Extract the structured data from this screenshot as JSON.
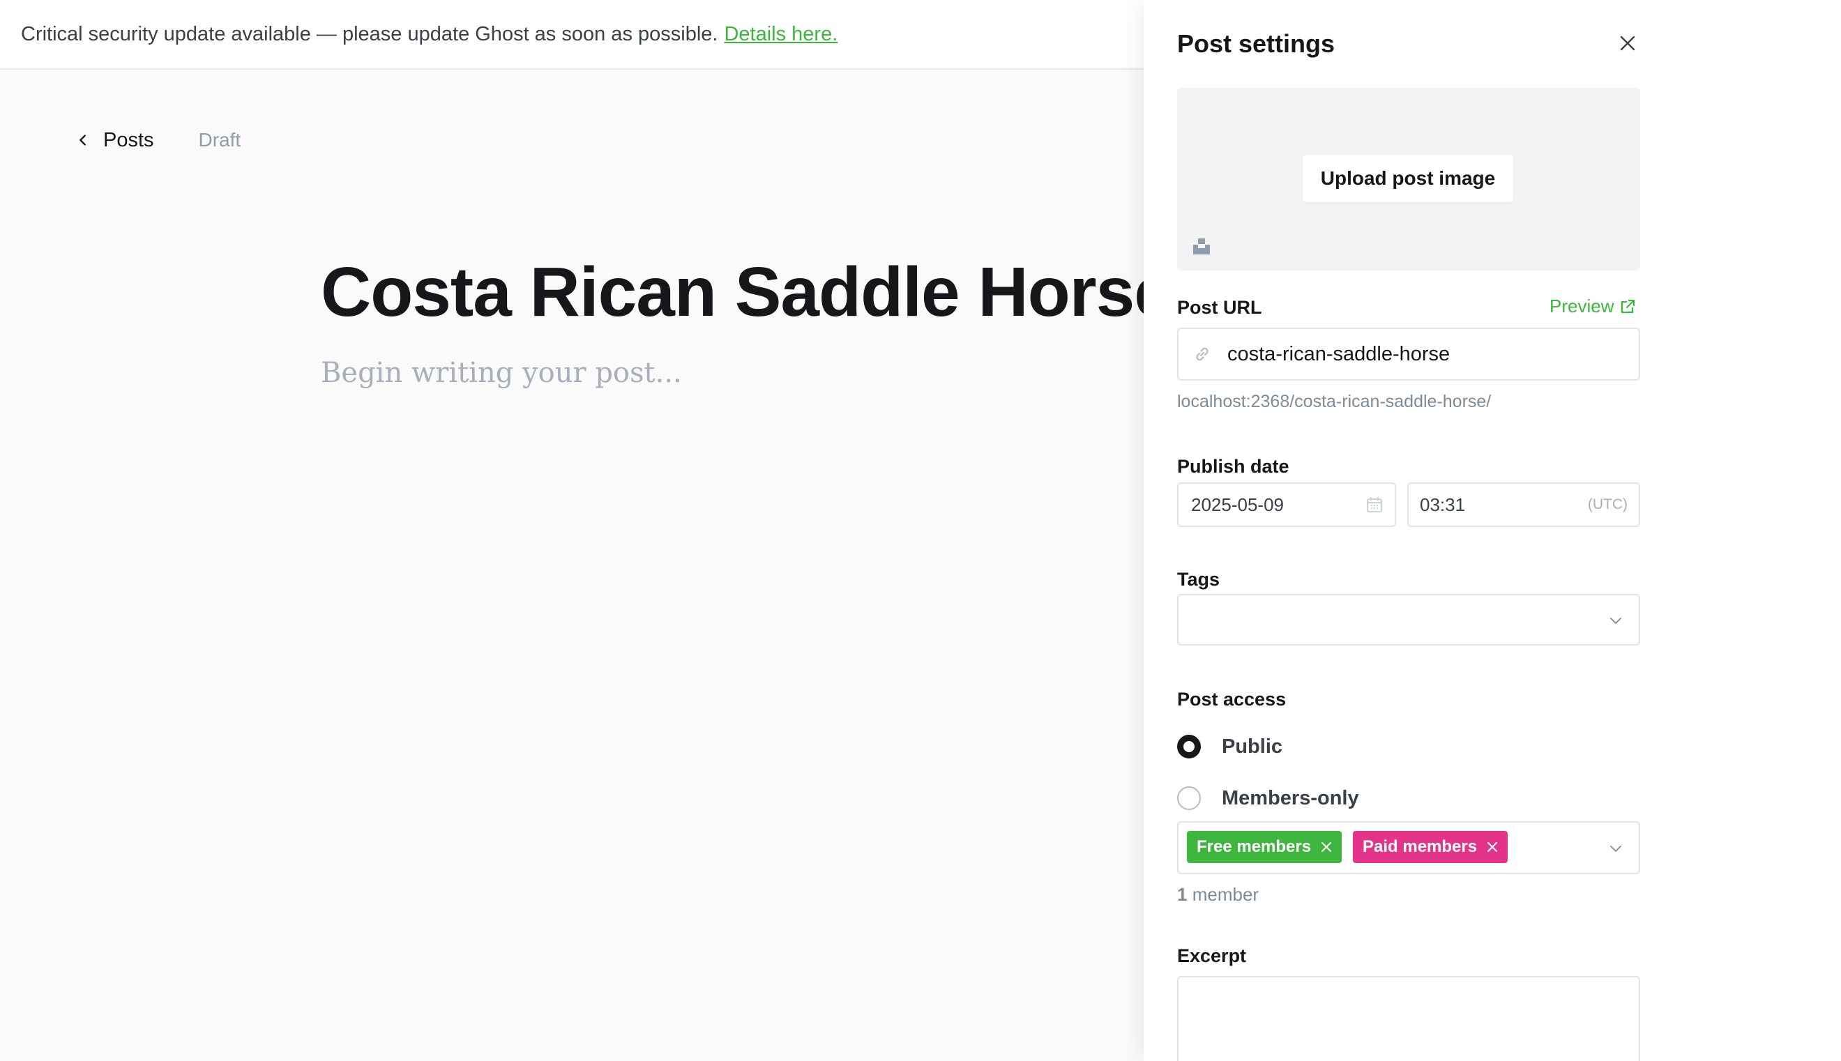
{
  "alert": {
    "message": "Critical security update available — please update Ghost as soon as possible.",
    "link_text": "Details here."
  },
  "editor": {
    "back_label": "Posts",
    "status": "Draft",
    "title": "Costa Rican Saddle Horse",
    "body_placeholder": "Begin writing your post..."
  },
  "settings": {
    "title": "Post settings",
    "upload_image_label": "Upload post image",
    "post_url_label": "Post URL",
    "preview_label": "Preview",
    "slug": "costa-rican-saddle-horse",
    "full_url": "localhost:2368/costa-rican-saddle-horse/",
    "publish_date_label": "Publish date",
    "date": "2025-05-09",
    "time": "03:31",
    "timezone": "(UTC)",
    "tags_label": "Tags",
    "post_access_label": "Post access",
    "access_options": [
      {
        "label": "Public",
        "selected": true
      },
      {
        "label": "Members-only",
        "selected": false
      }
    ],
    "segments": [
      {
        "label": "Free members",
        "color": "#3eb63e"
      },
      {
        "label": "Paid members",
        "color": "#e4348a"
      }
    ],
    "member_count": "1",
    "member_count_suffix": "member",
    "excerpt_label": "Excerpt"
  },
  "icons": [
    "chevron-left-icon",
    "close-icon",
    "unsplash-icon",
    "external-link-icon",
    "link-icon",
    "calendar-icon",
    "chevron-down-icon",
    "remove-token-icon"
  ],
  "colors": {
    "accent_green": "#3eb63e",
    "accent_pink": "#e4348a",
    "text_dark": "#15171a",
    "muted": "#7c8b9a"
  }
}
